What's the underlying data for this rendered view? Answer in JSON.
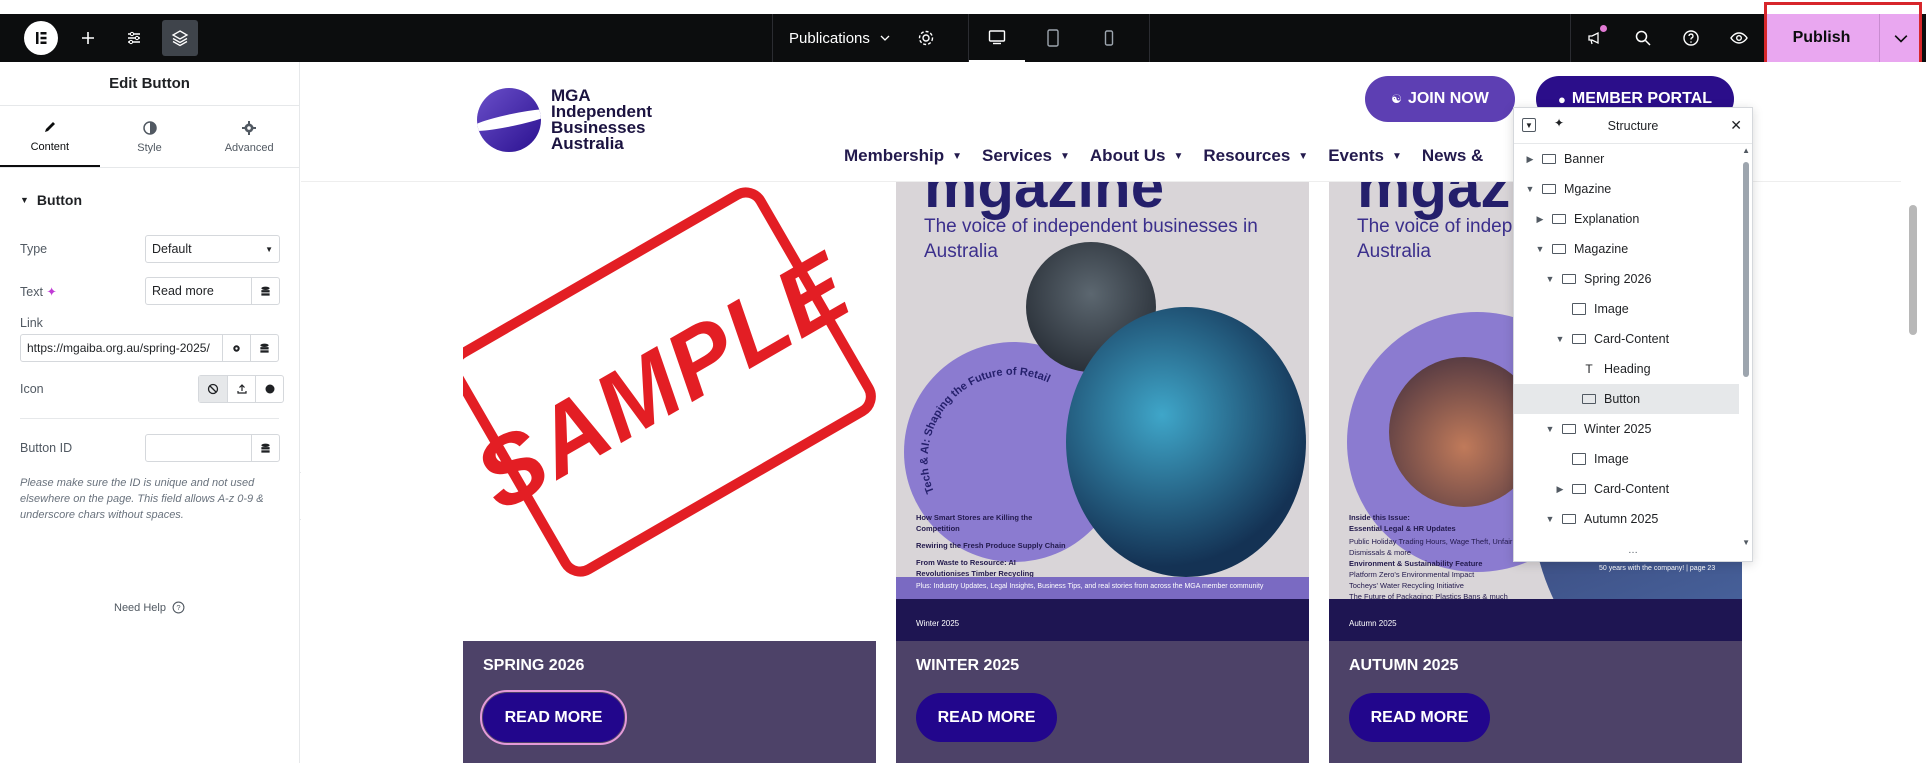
{
  "topbar": {
    "document_title": "Publications",
    "publish_label": "Publish"
  },
  "panel": {
    "title": "Edit Button",
    "tabs": [
      {
        "label": "Content"
      },
      {
        "label": "Style"
      },
      {
        "label": "Advanced"
      }
    ],
    "section_title": "Button",
    "type_label": "Type",
    "type_value": "Default",
    "text_label": "Text",
    "text_value": "Read more",
    "link_label": "Link",
    "link_value": "https://mgaiba.org.au/spring-2025/",
    "icon_label": "Icon",
    "button_id_label": "Button ID",
    "button_id_value": "",
    "help_text": "Please make sure the ID is unique and not used elsewhere on the page. This field allows A-z 0-9 & underscore chars without spaces.",
    "need_help": "Need Help"
  },
  "site": {
    "brand_lines": [
      "MGA",
      "Independent",
      "Businesses",
      "Australia"
    ],
    "join_label": "JOIN NOW",
    "member_label": "MEMBER PORTAL",
    "nav": [
      "Membership",
      "Services",
      "About Us",
      "Resources",
      "Events",
      "News &"
    ]
  },
  "cards": [
    {
      "title": "SPRING 2026",
      "button": "READ MORE",
      "stamp": "SAMPLE"
    },
    {
      "title": "WINTER 2025",
      "button": "READ MORE",
      "mag_sub": "The voice of independent businesses in Australia",
      "mag_top": "mgazine",
      "mag_issue": "Winter 2025",
      "mag_lines": [
        "How Smart Stores are Killing the Competition",
        "Rewiring the Fresh Produce Supply Chain",
        "From Waste to Resource: AI Revolutionises Timber Recycling"
      ],
      "mag_band": "Plus: Industry Updates, Legal Insights, Business Tips, and real stories from across the MGA member community",
      "mag_circle_text": "Tech & AI: Shaping the Future of Retail"
    },
    {
      "title": "AUTUMN 2025",
      "button": "READ MORE",
      "mag_sub": "The voice of independent businesses in Australia",
      "mag_top": "mgazine",
      "mag_issue": "Autumn 2025",
      "mag_lines": [
        "Inside this Issue:",
        "Essential Legal & HR Updates",
        "Public Holiday Trading Hours, Wage Theft, Unfair Dismissals & more",
        "Environment & Sustainability Feature",
        "Platform Zero's Environmental Impact",
        "Tocheys' Water Recycling Initiative",
        "The Future of Packaging: Plastics Bans & much more!"
      ],
      "mag_band": "50 years with the company! | page 23"
    }
  ],
  "structure": {
    "title": "Structure",
    "items": [
      {
        "label": "Banner"
      },
      {
        "label": "Mgazine"
      },
      {
        "label": "Explanation"
      },
      {
        "label": "Magazine"
      },
      {
        "label": "Spring 2026"
      },
      {
        "label": "Image"
      },
      {
        "label": "Card-Content"
      },
      {
        "label": "Heading"
      },
      {
        "label": "Button"
      },
      {
        "label": "Winter 2025"
      },
      {
        "label": "Image"
      },
      {
        "label": "Card-Content"
      },
      {
        "label": "Autumn 2025"
      }
    ]
  },
  "colors": {
    "publish": "#e9a7f0",
    "highlight_outline": "#d7262b",
    "brand_dark": "#2b0e8a",
    "card_footer": "#4d4268"
  }
}
